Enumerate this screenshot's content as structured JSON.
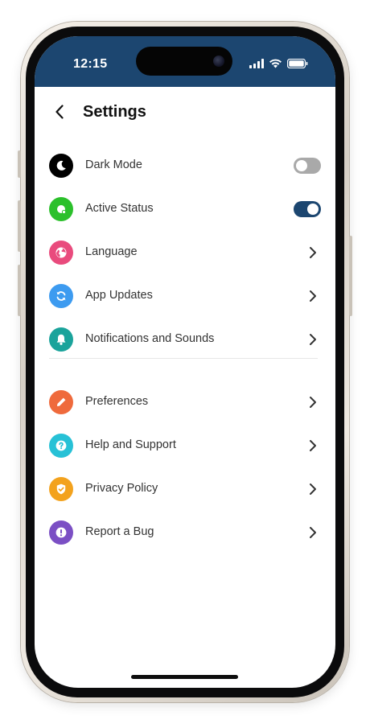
{
  "status_bar": {
    "time": "12:15",
    "background": "#1c4670",
    "icons": [
      "signal-icon",
      "wifi-icon",
      "battery-icon"
    ]
  },
  "header": {
    "title": "Settings",
    "back_icon": "chevron-left-icon"
  },
  "settings": {
    "group1": [
      {
        "label": "Dark Mode",
        "icon": "moon-icon",
        "icon_color": "#000000",
        "control": "toggle",
        "enabled": false
      },
      {
        "label": "Active Status",
        "icon": "status-dot-icon",
        "icon_color": "#2bc02b",
        "control": "toggle",
        "enabled": true
      },
      {
        "label": "Language",
        "icon": "globe-icon",
        "icon_color": "#e94b7d",
        "control": "chevron"
      },
      {
        "label": "App Updates",
        "icon": "sync-icon",
        "icon_color": "#3d9bf0",
        "control": "chevron"
      },
      {
        "label": "Notifications and Sounds",
        "icon": "bell-icon",
        "icon_color": "#1aa39b",
        "control": "chevron"
      }
    ],
    "group2": [
      {
        "label": "Preferences",
        "icon": "pencil-icon",
        "icon_color": "#ef6a3c",
        "control": "chevron"
      },
      {
        "label": "Help and Support",
        "icon": "question-icon",
        "icon_color": "#27c1d6",
        "control": "chevron"
      },
      {
        "label": "Privacy Policy",
        "icon": "shield-check-icon",
        "icon_color": "#f3a21d",
        "control": "chevron"
      },
      {
        "label": "Report a Bug",
        "icon": "exclamation-icon",
        "icon_color": "#7b4fc4",
        "control": "chevron"
      }
    ]
  },
  "colors": {
    "toggle_on": "#1c4670",
    "toggle_off": "#a9a9a9"
  }
}
